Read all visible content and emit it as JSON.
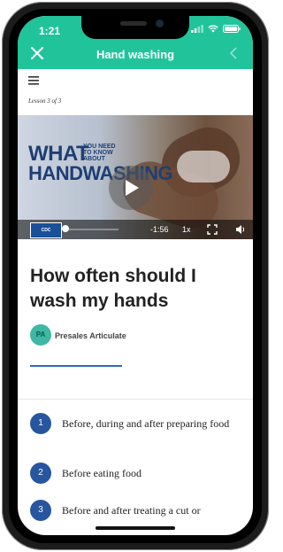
{
  "status": {
    "time": "1:21"
  },
  "header": {
    "title": "Hand washing"
  },
  "lesson": {
    "progress_text": "Lesson 3 of 3"
  },
  "video": {
    "title_line1": "WHAT",
    "title_small": "YOU NEED TO KNOW ABOUT",
    "title_line2": "HANDWASHING",
    "logo_text": "CDC",
    "time_remaining": "-1:56",
    "speed": "1x"
  },
  "content": {
    "heading": "How often should I wash my hands",
    "author_initials": "PA",
    "author_name": "Presales Articulate"
  },
  "steps": [
    {
      "number": "1",
      "text": "Before, during and after preparing food"
    },
    {
      "number": "2",
      "text": "Before eating food"
    },
    {
      "number": "3",
      "text": "Before and after treating a cut or"
    }
  ],
  "colors": {
    "accent": "#21c49a",
    "primary_blue": "#27569e"
  }
}
